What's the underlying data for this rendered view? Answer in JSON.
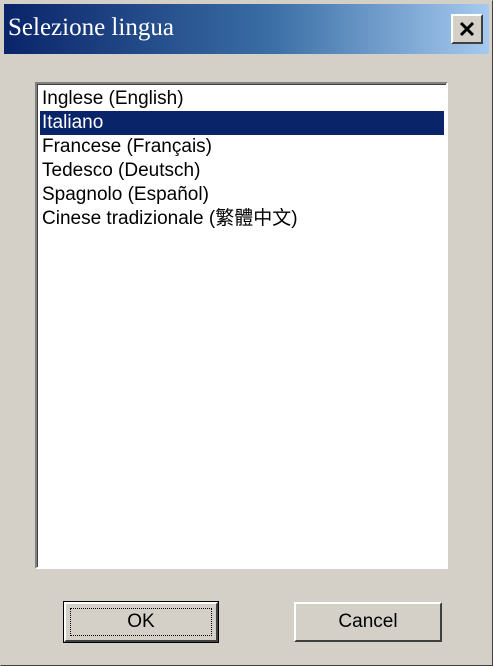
{
  "window": {
    "title": "Selezione lingua",
    "close_icon": "close-icon"
  },
  "language_list": {
    "selected_index": 1,
    "items": [
      {
        "label": "Inglese (English)"
      },
      {
        "label": "Italiano"
      },
      {
        "label": "Francese (Français)"
      },
      {
        "label": "Tedesco (Deutsch)"
      },
      {
        "label": "Spagnolo (Español)"
      },
      {
        "label": "Cinese tradizionale (繁體中文)"
      }
    ]
  },
  "buttons": {
    "ok_label": "OK",
    "cancel_label": "Cancel"
  },
  "colors": {
    "selection": "#0a246a",
    "face": "#d4d0c8"
  }
}
